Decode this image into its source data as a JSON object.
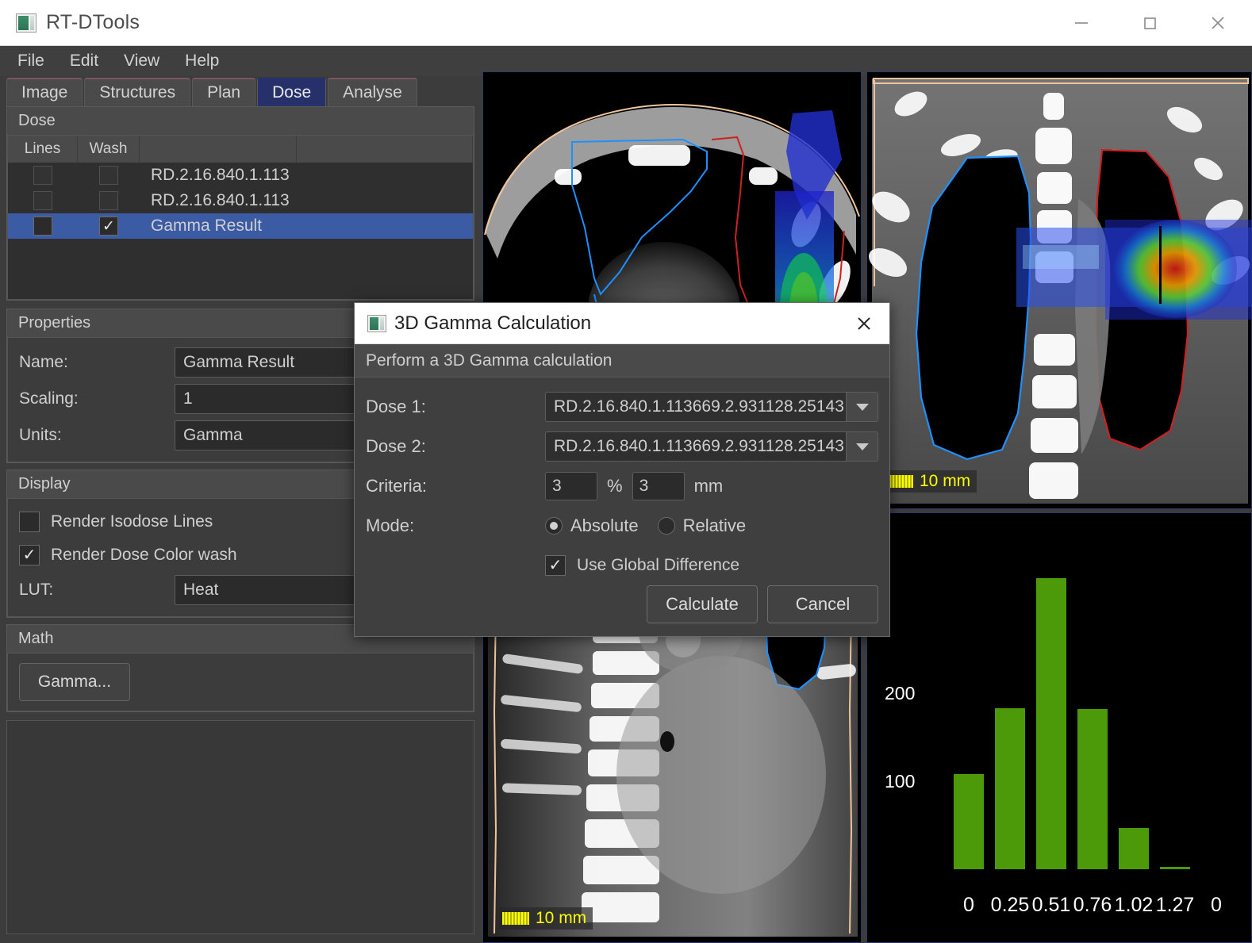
{
  "window": {
    "title": "RT-DTools",
    "icon": "app-icon",
    "minimize": "—",
    "maximize": "□",
    "close": "✕"
  },
  "menubar": {
    "items": [
      "File",
      "Edit",
      "View",
      "Help"
    ]
  },
  "tabs": [
    {
      "label": "Image",
      "active": false
    },
    {
      "label": "Structures",
      "active": false
    },
    {
      "label": "Plan",
      "active": false
    },
    {
      "label": "Dose",
      "active": true
    },
    {
      "label": "Analyse",
      "active": false
    }
  ],
  "dose_group": {
    "header": "Dose",
    "columns": [
      "Lines",
      "Wash",
      "",
      ""
    ],
    "rows": [
      {
        "lines": false,
        "wash": false,
        "name": "RD.2.16.840.1.113",
        "selected": false
      },
      {
        "lines": false,
        "wash": false,
        "name": "RD.2.16.840.1.113",
        "selected": false
      },
      {
        "lines": false,
        "wash": true,
        "name": "Gamma Result",
        "selected": true
      }
    ]
  },
  "properties": {
    "header": "Properties",
    "fields": [
      {
        "label": "Name:",
        "value": "Gamma Result"
      },
      {
        "label": "Scaling:",
        "value": "1"
      },
      {
        "label": "Units:",
        "value": "Gamma"
      }
    ]
  },
  "display": {
    "header": "Display",
    "checkboxes": [
      {
        "label": "Render Isodose Lines",
        "checked": false
      },
      {
        "label": "Render Dose Color wash",
        "checked": true
      }
    ],
    "lut_label": "LUT:",
    "lut_value": "Heat"
  },
  "math": {
    "header": "Math",
    "gamma_button": "Gamma..."
  },
  "viewports": {
    "axial": {
      "name": "axial-ct-view",
      "scalebar": "10 mm",
      "scalebar_visible": false
    },
    "coronal": {
      "name": "coronal-ct-view",
      "scalebar": "10 mm",
      "scalebar_visible": true
    },
    "sagittal": {
      "name": "sagittal-ct-view",
      "scalebar": "10 mm",
      "scalebar_visible": true
    }
  },
  "dialog": {
    "title": "3D Gamma Calculation",
    "subtitle": "Perform a 3D Gamma calculation",
    "close_glyph": "✕",
    "dose1_label": "Dose 1:",
    "dose1_value": "RD.2.16.840.1.113669.2.931128.25143",
    "dose2_label": "Dose 2:",
    "dose2_value": "RD.2.16.840.1.113669.2.931128.25143",
    "criteria_label": "Criteria:",
    "criteria_percent": "3",
    "percent_unit": "%",
    "criteria_mm": "3",
    "mm_unit": "mm",
    "mode_label": "Mode:",
    "mode_absolute": "Absolute",
    "mode_relative": "Relative",
    "mode_selected": "Absolute",
    "global_diff_label": "Use Global Difference",
    "global_diff_checked": true,
    "calculate_button": "Calculate",
    "cancel_button": "Cancel"
  },
  "chart_data": {
    "type": "bar",
    "title": "",
    "xlabel": "",
    "ylabel": "",
    "categories": [
      "0",
      "0.25",
      "0.51",
      "0.76",
      "1.02",
      "1.27",
      "0"
    ],
    "values": [
      108,
      183,
      330,
      182,
      47,
      2,
      0
    ],
    "ytick_labels": [
      "200",
      "100"
    ],
    "ytick_values": [
      200,
      100
    ],
    "ylim": [
      0,
      360
    ],
    "bar_color": "#4c9a09",
    "background": "#000000",
    "grid": false,
    "legend": null
  }
}
